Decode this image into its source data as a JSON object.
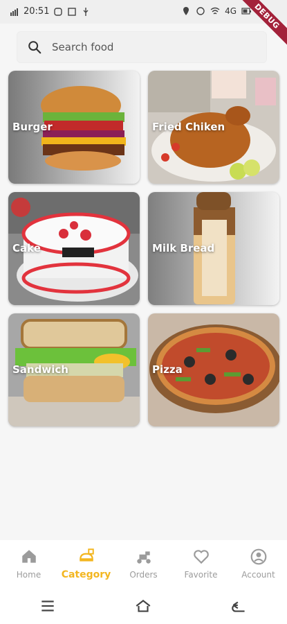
{
  "status_bar": {
    "time": "20:51",
    "battery": "4G",
    "debug_label": "DEBUG"
  },
  "search": {
    "placeholder": "Search food"
  },
  "categories": [
    {
      "label": "Burger"
    },
    {
      "label": "Fried Chiken"
    },
    {
      "label": "Cake"
    },
    {
      "label": "Milk Bread"
    },
    {
      "label": "Sandwich"
    },
    {
      "label": "Pizza"
    }
  ],
  "bottom_nav": {
    "items": [
      {
        "label": "Home",
        "icon": "home-icon"
      },
      {
        "label": "Category",
        "icon": "category-icon"
      },
      {
        "label": "Orders",
        "icon": "orders-icon"
      },
      {
        "label": "Favorite",
        "icon": "heart-icon"
      },
      {
        "label": "Account",
        "icon": "account-icon"
      }
    ],
    "active_index": 1,
    "active_color": "#f3b61f",
    "inactive_color": "#9b9b9b"
  }
}
